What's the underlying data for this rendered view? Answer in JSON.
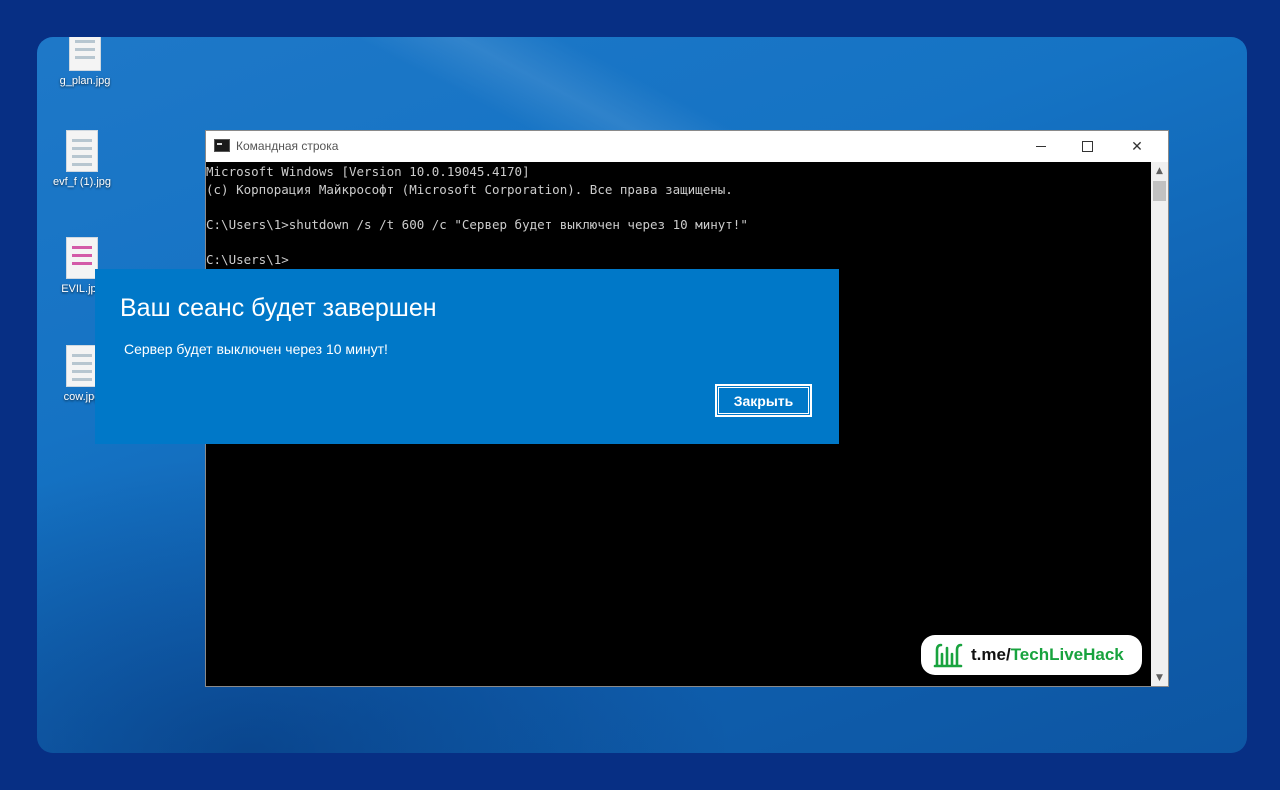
{
  "desktop": {
    "icons": [
      {
        "label": "g_plan.jpg",
        "pink": false
      },
      {
        "label": "evf_f (1).jpg",
        "pink": false
      },
      {
        "label": "EVIL.jpg",
        "pink": true
      },
      {
        "label": "cow.jpg",
        "pink": false
      }
    ]
  },
  "cmd_window": {
    "title": "Командная строка",
    "lines": [
      "Microsoft Windows [Version 10.0.19045.4170]",
      "(c) Корпорация Майкрософт (Microsoft Corporation). Все права защищены.",
      "",
      "C:\\Users\\1>shutdown /s /t 600 /c \"Сервер будет выключен через 10 минут!\"",
      "",
      "C:\\Users\\1>"
    ]
  },
  "dialog": {
    "heading": "Ваш сеанс будет завершен",
    "message": "Сервер будет выключен через 10 минут!",
    "close_label": "Закрыть",
    "accent": "#0078c8"
  },
  "watermark": {
    "prefix": "t.me/",
    "brand": "TechLiveHack",
    "brand_color": "#18a33e"
  }
}
